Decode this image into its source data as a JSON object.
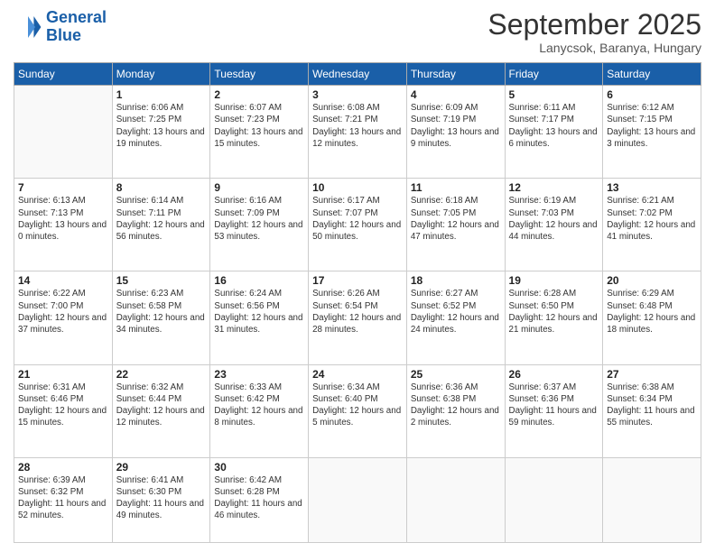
{
  "logo": {
    "line1": "General",
    "line2": "Blue"
  },
  "title": "September 2025",
  "subtitle": "Lanycsok, Baranya, Hungary",
  "weekdays": [
    "Sunday",
    "Monday",
    "Tuesday",
    "Wednesday",
    "Thursday",
    "Friday",
    "Saturday"
  ],
  "weeks": [
    [
      {
        "day": "",
        "sunrise": "",
        "sunset": "",
        "daylight": ""
      },
      {
        "day": "1",
        "sunrise": "Sunrise: 6:06 AM",
        "sunset": "Sunset: 7:25 PM",
        "daylight": "Daylight: 13 hours and 19 minutes."
      },
      {
        "day": "2",
        "sunrise": "Sunrise: 6:07 AM",
        "sunset": "Sunset: 7:23 PM",
        "daylight": "Daylight: 13 hours and 15 minutes."
      },
      {
        "day": "3",
        "sunrise": "Sunrise: 6:08 AM",
        "sunset": "Sunset: 7:21 PM",
        "daylight": "Daylight: 13 hours and 12 minutes."
      },
      {
        "day": "4",
        "sunrise": "Sunrise: 6:09 AM",
        "sunset": "Sunset: 7:19 PM",
        "daylight": "Daylight: 13 hours and 9 minutes."
      },
      {
        "day": "5",
        "sunrise": "Sunrise: 6:11 AM",
        "sunset": "Sunset: 7:17 PM",
        "daylight": "Daylight: 13 hours and 6 minutes."
      },
      {
        "day": "6",
        "sunrise": "Sunrise: 6:12 AM",
        "sunset": "Sunset: 7:15 PM",
        "daylight": "Daylight: 13 hours and 3 minutes."
      }
    ],
    [
      {
        "day": "7",
        "sunrise": "Sunrise: 6:13 AM",
        "sunset": "Sunset: 7:13 PM",
        "daylight": "Daylight: 13 hours and 0 minutes."
      },
      {
        "day": "8",
        "sunrise": "Sunrise: 6:14 AM",
        "sunset": "Sunset: 7:11 PM",
        "daylight": "Daylight: 12 hours and 56 minutes."
      },
      {
        "day": "9",
        "sunrise": "Sunrise: 6:16 AM",
        "sunset": "Sunset: 7:09 PM",
        "daylight": "Daylight: 12 hours and 53 minutes."
      },
      {
        "day": "10",
        "sunrise": "Sunrise: 6:17 AM",
        "sunset": "Sunset: 7:07 PM",
        "daylight": "Daylight: 12 hours and 50 minutes."
      },
      {
        "day": "11",
        "sunrise": "Sunrise: 6:18 AM",
        "sunset": "Sunset: 7:05 PM",
        "daylight": "Daylight: 12 hours and 47 minutes."
      },
      {
        "day": "12",
        "sunrise": "Sunrise: 6:19 AM",
        "sunset": "Sunset: 7:03 PM",
        "daylight": "Daylight: 12 hours and 44 minutes."
      },
      {
        "day": "13",
        "sunrise": "Sunrise: 6:21 AM",
        "sunset": "Sunset: 7:02 PM",
        "daylight": "Daylight: 12 hours and 41 minutes."
      }
    ],
    [
      {
        "day": "14",
        "sunrise": "Sunrise: 6:22 AM",
        "sunset": "Sunset: 7:00 PM",
        "daylight": "Daylight: 12 hours and 37 minutes."
      },
      {
        "day": "15",
        "sunrise": "Sunrise: 6:23 AM",
        "sunset": "Sunset: 6:58 PM",
        "daylight": "Daylight: 12 hours and 34 minutes."
      },
      {
        "day": "16",
        "sunrise": "Sunrise: 6:24 AM",
        "sunset": "Sunset: 6:56 PM",
        "daylight": "Daylight: 12 hours and 31 minutes."
      },
      {
        "day": "17",
        "sunrise": "Sunrise: 6:26 AM",
        "sunset": "Sunset: 6:54 PM",
        "daylight": "Daylight: 12 hours and 28 minutes."
      },
      {
        "day": "18",
        "sunrise": "Sunrise: 6:27 AM",
        "sunset": "Sunset: 6:52 PM",
        "daylight": "Daylight: 12 hours and 24 minutes."
      },
      {
        "day": "19",
        "sunrise": "Sunrise: 6:28 AM",
        "sunset": "Sunset: 6:50 PM",
        "daylight": "Daylight: 12 hours and 21 minutes."
      },
      {
        "day": "20",
        "sunrise": "Sunrise: 6:29 AM",
        "sunset": "Sunset: 6:48 PM",
        "daylight": "Daylight: 12 hours and 18 minutes."
      }
    ],
    [
      {
        "day": "21",
        "sunrise": "Sunrise: 6:31 AM",
        "sunset": "Sunset: 6:46 PM",
        "daylight": "Daylight: 12 hours and 15 minutes."
      },
      {
        "day": "22",
        "sunrise": "Sunrise: 6:32 AM",
        "sunset": "Sunset: 6:44 PM",
        "daylight": "Daylight: 12 hours and 12 minutes."
      },
      {
        "day": "23",
        "sunrise": "Sunrise: 6:33 AM",
        "sunset": "Sunset: 6:42 PM",
        "daylight": "Daylight: 12 hours and 8 minutes."
      },
      {
        "day": "24",
        "sunrise": "Sunrise: 6:34 AM",
        "sunset": "Sunset: 6:40 PM",
        "daylight": "Daylight: 12 hours and 5 minutes."
      },
      {
        "day": "25",
        "sunrise": "Sunrise: 6:36 AM",
        "sunset": "Sunset: 6:38 PM",
        "daylight": "Daylight: 12 hours and 2 minutes."
      },
      {
        "day": "26",
        "sunrise": "Sunrise: 6:37 AM",
        "sunset": "Sunset: 6:36 PM",
        "daylight": "Daylight: 11 hours and 59 minutes."
      },
      {
        "day": "27",
        "sunrise": "Sunrise: 6:38 AM",
        "sunset": "Sunset: 6:34 PM",
        "daylight": "Daylight: 11 hours and 55 minutes."
      }
    ],
    [
      {
        "day": "28",
        "sunrise": "Sunrise: 6:39 AM",
        "sunset": "Sunset: 6:32 PM",
        "daylight": "Daylight: 11 hours and 52 minutes."
      },
      {
        "day": "29",
        "sunrise": "Sunrise: 6:41 AM",
        "sunset": "Sunset: 6:30 PM",
        "daylight": "Daylight: 11 hours and 49 minutes."
      },
      {
        "day": "30",
        "sunrise": "Sunrise: 6:42 AM",
        "sunset": "Sunset: 6:28 PM",
        "daylight": "Daylight: 11 hours and 46 minutes."
      },
      {
        "day": "",
        "sunrise": "",
        "sunset": "",
        "daylight": ""
      },
      {
        "day": "",
        "sunrise": "",
        "sunset": "",
        "daylight": ""
      },
      {
        "day": "",
        "sunrise": "",
        "sunset": "",
        "daylight": ""
      },
      {
        "day": "",
        "sunrise": "",
        "sunset": "",
        "daylight": ""
      }
    ]
  ]
}
